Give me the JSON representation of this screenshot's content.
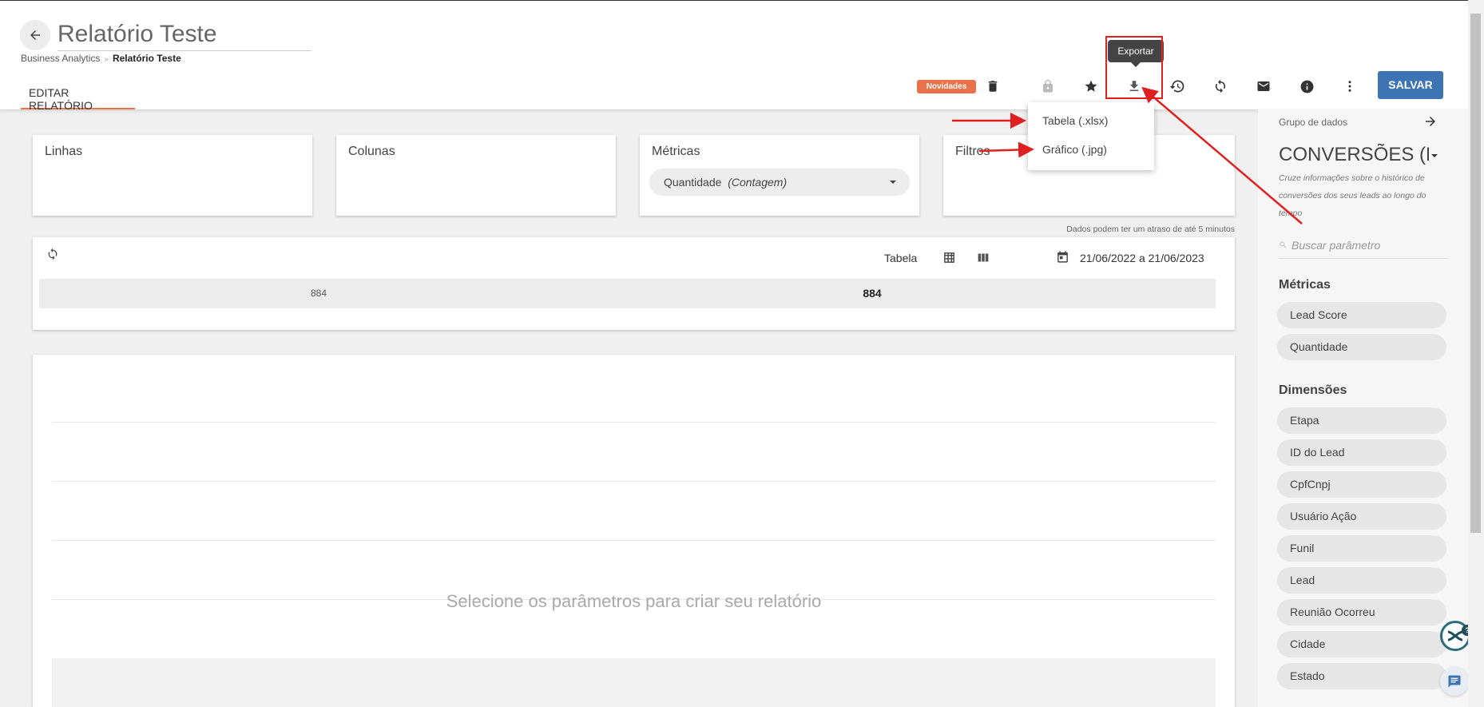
{
  "header": {
    "title": "Relatório Teste",
    "breadcrumb": {
      "root": "Business Analytics",
      "separator": "»",
      "current": "Relatório Teste"
    },
    "tab_label": "EDITAR RELATÓRIO",
    "badge": "Novidades",
    "save_label": "SALVAR",
    "tooltip": "Exportar"
  },
  "export_menu": {
    "items": [
      "Tabela (.xlsx)",
      "Gráfico (.jpg)"
    ]
  },
  "panels": {
    "lines_title": "Linhas",
    "columns_title": "Colunas",
    "metrics_title": "Métricas",
    "metric_chip": {
      "name": "Quantidade",
      "agg": "(Contagem)"
    },
    "filters_title": "Filtros"
  },
  "delay_note": "Dados podem ter um atraso de até 5 minutos",
  "table": {
    "view_label": "Tabela",
    "date_range": "21/06/2022 a 21/06/2023",
    "row_value_left": "884",
    "row_value_right": "884"
  },
  "chart_placeholder": "Selecione os parâmetros para criar seu relatório",
  "sidebar": {
    "group_label": "Grupo de dados",
    "group_name": "CONVERSÕES (Fu",
    "group_desc": "Cruze informações sobre o histórico de conversões dos seus leads ao longo do tempo",
    "search_placeholder": "Buscar parâmetro",
    "metrics_heading": "Métricas",
    "metrics": [
      "Lead Score",
      "Quantidade"
    ],
    "dimensions_heading": "Dimensões",
    "dimensions": [
      "Etapa",
      "ID do Lead",
      "CpfCnpj",
      "Usuário Ação",
      "Funil",
      "Lead",
      "Reunião Ocorreu",
      "Cidade",
      "Estado"
    ]
  },
  "colors": {
    "accent": "#e8734a",
    "primary": "#3d74b4",
    "annotation": "#e02020"
  },
  "icons": [
    "arrow-left-icon",
    "trash-icon",
    "lock-icon",
    "star-icon",
    "download-icon",
    "history-icon",
    "sync-icon",
    "mail-icon",
    "info-icon",
    "more-vert-icon",
    "refresh-icon",
    "grid-icon",
    "columns-icon",
    "calendar-icon",
    "arrow-right-icon",
    "search-icon",
    "chat-icon",
    "help-widget-icon"
  ]
}
